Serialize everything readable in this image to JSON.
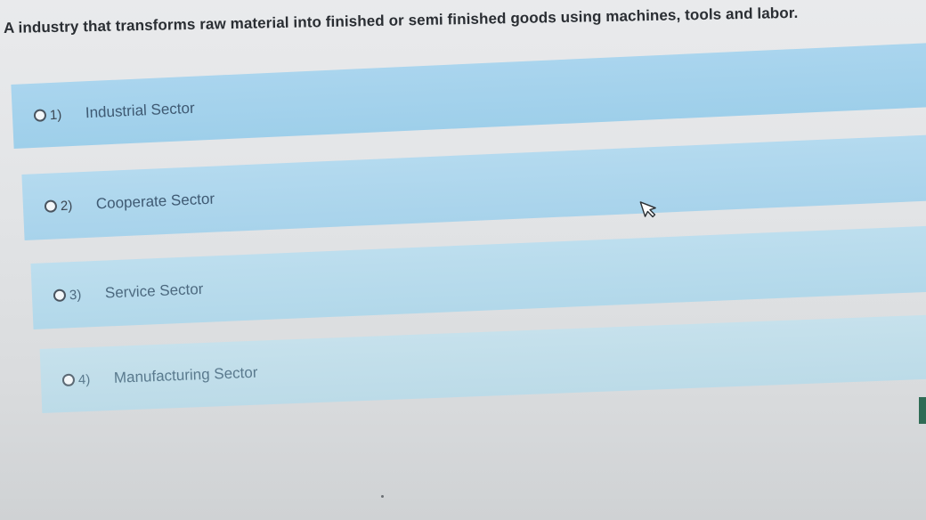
{
  "question": {
    "text": "A industry that transforms raw material into finished or semi finished goods using machines, tools and labor."
  },
  "options": [
    {
      "number": "1)",
      "label": "Industrial Sector"
    },
    {
      "number": "2)",
      "label": "Cooperate Sector"
    },
    {
      "number": "3)",
      "label": "Service Sector"
    },
    {
      "number": "4)",
      "label": "Manufacturing Sector"
    }
  ],
  "icons": {
    "cursor": "mouse-pointer-icon",
    "radio": "radio-unselected-icon"
  },
  "colors": {
    "option_background": "#a9d3ea",
    "question_text": "#2a2e33",
    "option_text": "#3f5a73"
  }
}
